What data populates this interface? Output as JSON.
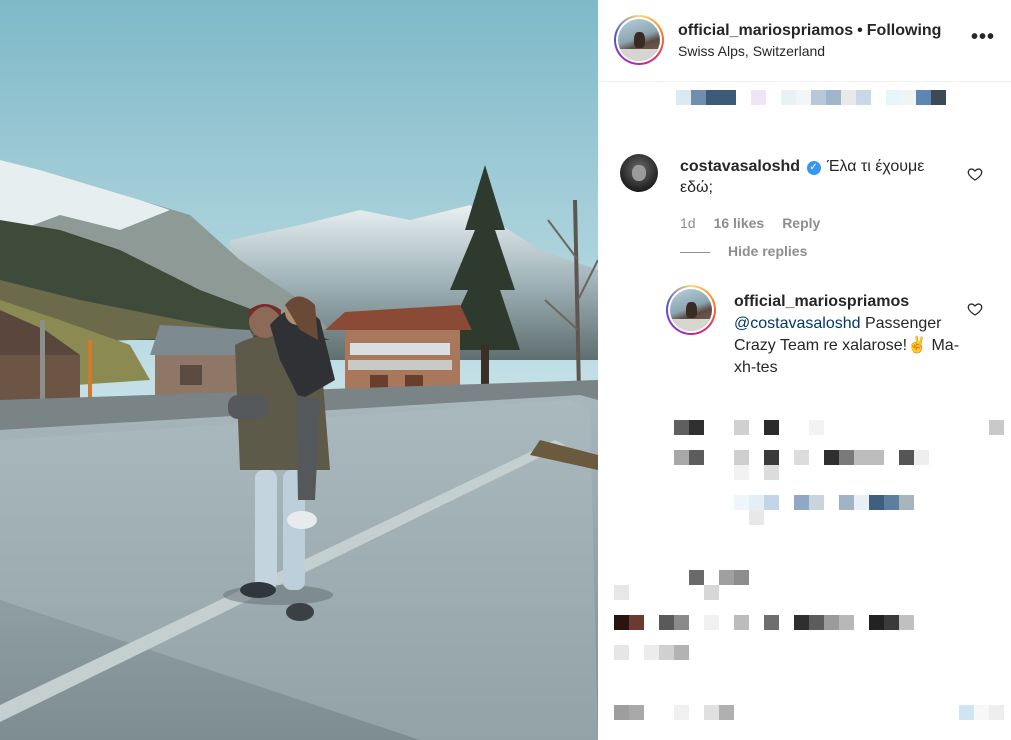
{
  "post": {
    "username": "official_mariospriamos",
    "separator": "•",
    "follow_state": "Following",
    "location": "Swiss Alps, Switzerland"
  },
  "icons": {
    "more": "more-options-icon",
    "heart": "heart-outline-icon",
    "verified": "verified-badge-icon"
  },
  "comment": {
    "username": "costavasaloshd",
    "text": "Έλα τι έχουμε εδώ;",
    "time": "1d",
    "likes": "16 likes",
    "reply_label": "Reply"
  },
  "hide_replies_label": "Hide replies",
  "reply": {
    "username": "official_mariospriamos",
    "mention": "@costavasaloshd",
    "text": "Passenger Crazy Team re xalarose!✌️ Ma-xh-tes"
  },
  "colors": {
    "verified": "#3897f0",
    "text": "#262626",
    "muted": "#8e8e8e",
    "mention": "#00376b"
  }
}
